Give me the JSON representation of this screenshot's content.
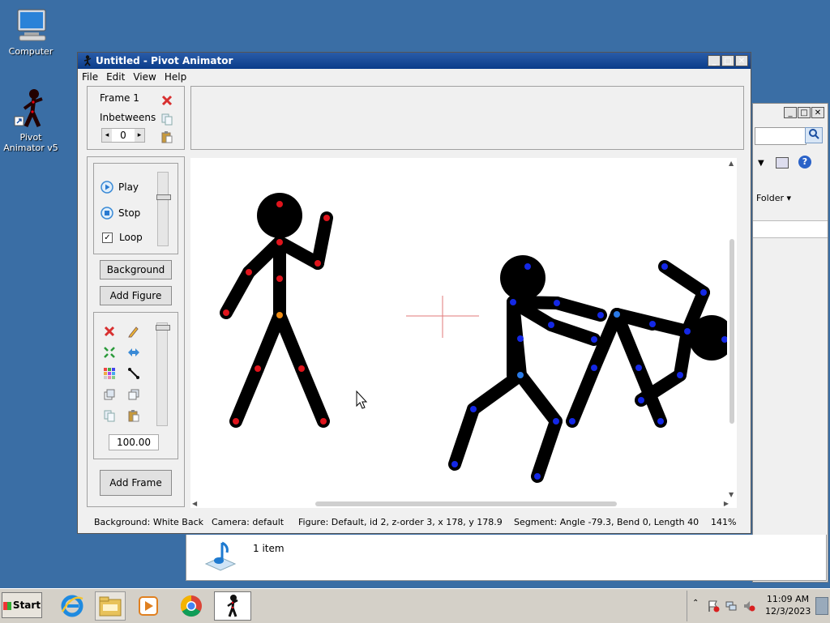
{
  "desktop": {
    "icons": [
      {
        "label": "Computer"
      },
      {
        "label": "Pivot Animator v5"
      }
    ]
  },
  "explorer": {
    "folder_label": "Folder",
    "item_count": "1 item"
  },
  "pivot": {
    "title": "Untitled - Pivot Animator",
    "menu": [
      "File",
      "Edit",
      "View",
      "Help"
    ],
    "frame_label": "Frame 1",
    "inbetweens_label": "Inbetweens",
    "inbetweens_value": "0",
    "play_label": "Play",
    "stop_label": "Stop",
    "loop_label": "Loop",
    "background_button": "Background",
    "add_figure_button": "Add Figure",
    "scale_value": "100.00",
    "add_frame_button": "Add Frame",
    "status": {
      "background": "Background: White Back",
      "camera": "Camera: default",
      "figure": "Figure: Default, id 2, z-order 3, x 178, y 178.9",
      "segment": "Segment: Angle -79.3, Bend 0, Length 40",
      "zoom": "141%"
    }
  },
  "taskbar": {
    "start_label": "Start",
    "time": "11:09 AM",
    "date": "12/3/2023"
  },
  "colors": {
    "desktop": "#3a6ea5",
    "red_joint": "#e0141c",
    "blue_joint": "#1428e6",
    "orange_joint": "#f08c14"
  }
}
